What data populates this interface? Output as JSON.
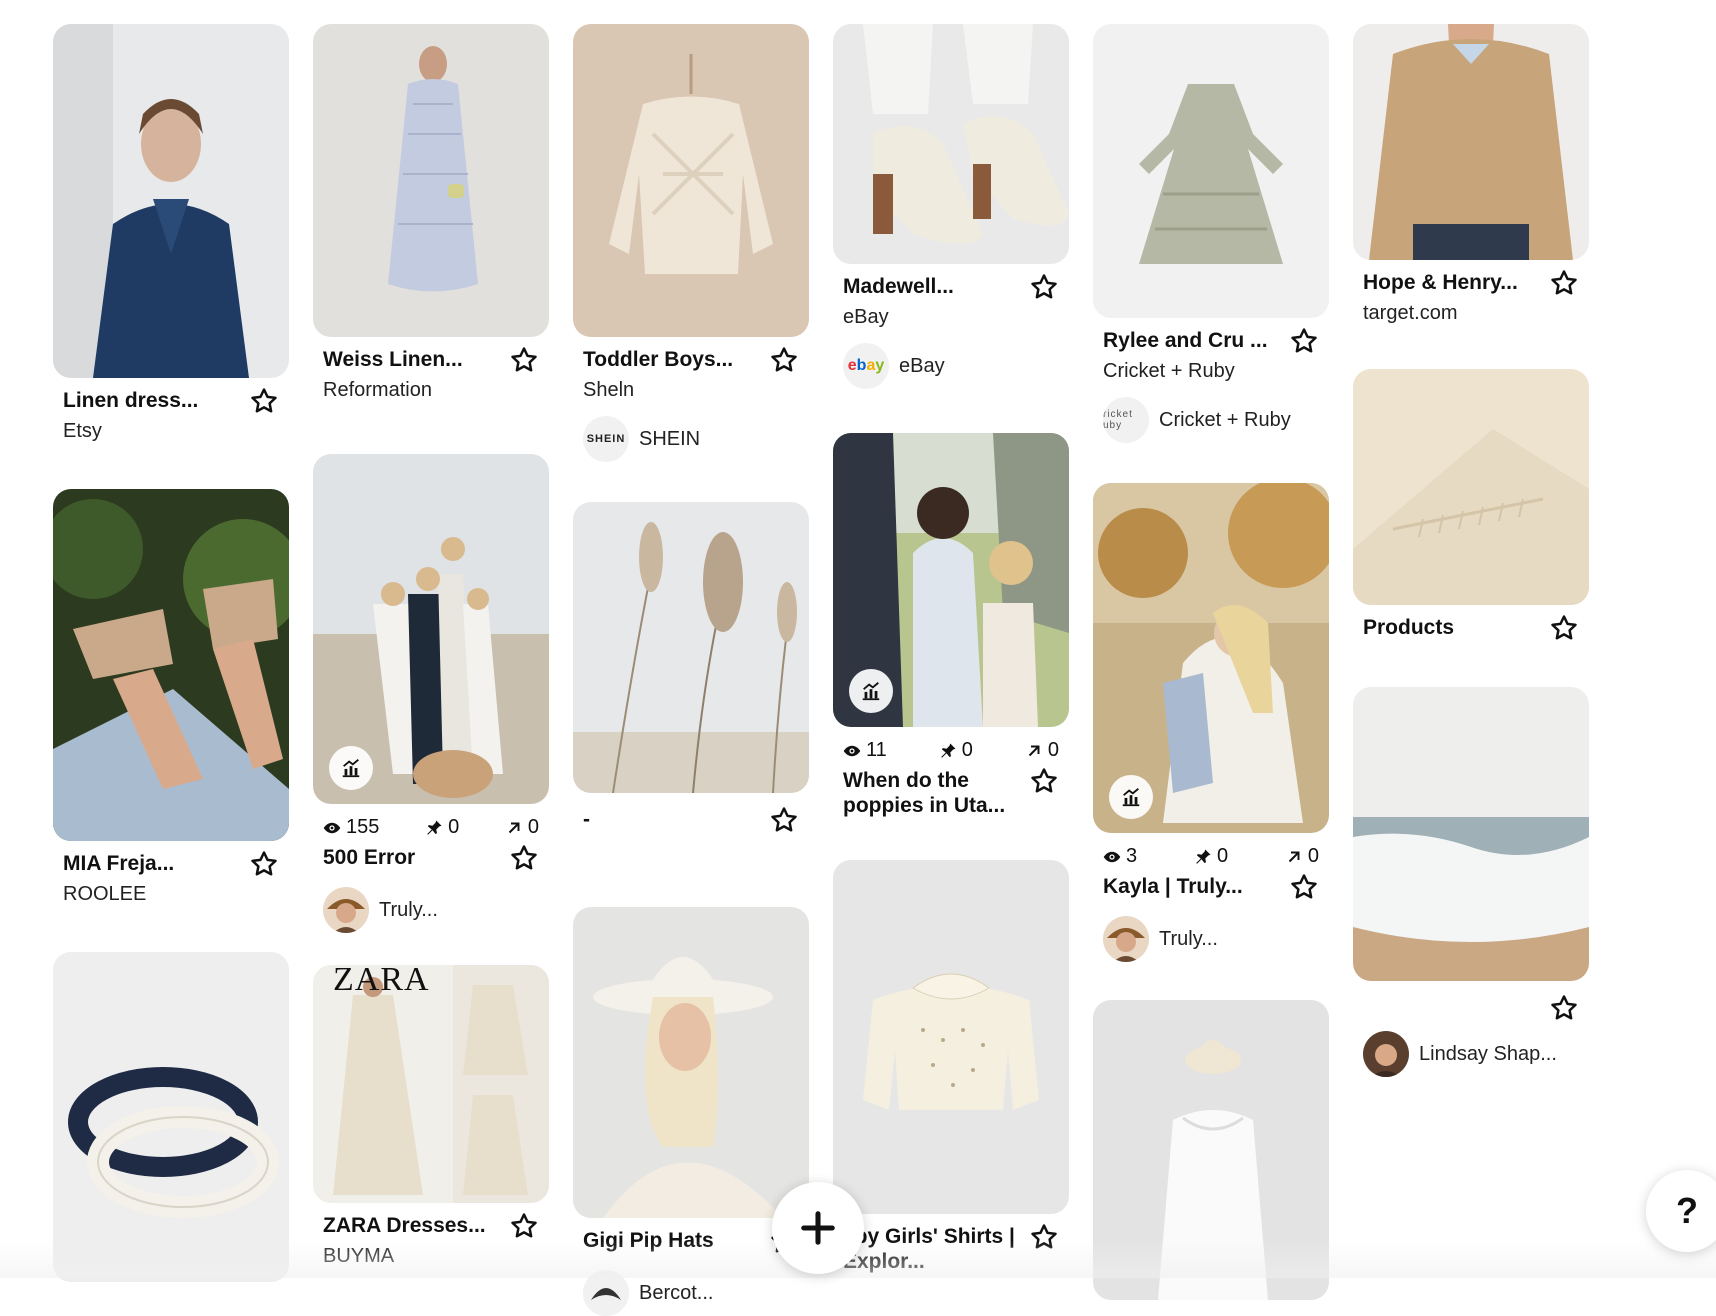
{
  "columns": [
    {
      "pins": [
        {
          "title": "Linen dress...",
          "subtitle": "Etsy",
          "image": "navy-linen-wrap-dress-photo"
        },
        {
          "title": "MIA Freja...",
          "subtitle": "ROOLEE",
          "image": "platform-clog-sandals-photo"
        },
        {
          "title": "",
          "image": "braided-headbands-photo"
        }
      ]
    },
    {
      "pins": [
        {
          "title": "Weiss Linen...",
          "subtitle": "Reformation",
          "image": "blue-striped-linen-dress-photo"
        },
        {
          "title": "500 Error",
          "views": "155",
          "saves": "0",
          "clicks": "0",
          "source": "Truly...",
          "image": "family-beach-photo"
        },
        {
          "title": "ZARA Dresses...",
          "subtitle": "BUYMA",
          "brand": "ZARA",
          "image": "cream-lace-dress-photo"
        }
      ]
    },
    {
      "pins": [
        {
          "title": "Toddler Boys...",
          "subtitle": "Sheln",
          "source": "SHEIN",
          "source_logo": "SHEIN",
          "image": "cable-knit-sweater-photo"
        },
        {
          "title": "-",
          "image": "pampas-grass-photo"
        },
        {
          "title": "Gigi Pip Hats",
          "source": "Bercot...",
          "image": "woman-white-hat-photo"
        }
      ]
    },
    {
      "pins": [
        {
          "title": "Madewell...",
          "subtitle": "eBay",
          "source": "eBay",
          "source_logo": "ebay",
          "image": "cream-mule-heels-photo"
        },
        {
          "title": "When do the poppies in Uta...",
          "views": "11",
          "saves": "0",
          "clicks": "0",
          "image": "family-field-photo"
        },
        {
          "title": "aby Girls' Shirts | Explor...",
          "image": "polka-dot-blouse-photo"
        }
      ]
    },
    {
      "pins": [
        {
          "title": "Rylee and Cru ...",
          "subtitle": "Cricket + Ruby",
          "source": "Cricket + Ruby",
          "source_logo": "ricket uby",
          "image": "sage-tiered-dress-photo"
        },
        {
          "title": "Kayla | Truly...",
          "views": "3",
          "saves": "0",
          "clicks": "0",
          "source": "Truly...",
          "image": "mother-child-field-photo"
        },
        {
          "title": "",
          "image": "white-christening-dress-photo"
        }
      ]
    },
    {
      "pins": [
        {
          "title": "Hope & Henry...",
          "subtitle": "target.com",
          "image": "tan-sweater-man-photo"
        },
        {
          "title": "Products",
          "image": "cream-fringe-blanket-photo"
        },
        {
          "title": "",
          "source": "Lindsay Shap...",
          "image": "ocean-waves-photo"
        }
      ]
    }
  ],
  "icons": {
    "star": "star-outline-icon",
    "stats": "stats-chart-icon",
    "views": "eye-icon",
    "saves": "pin-icon",
    "clicks": "outbound-arrow-icon",
    "fab": "plus-icon"
  },
  "help_label": "?",
  "colors": {
    "text": "#111111",
    "card_bg": "#efefef",
    "navy": "#1f3a63"
  }
}
